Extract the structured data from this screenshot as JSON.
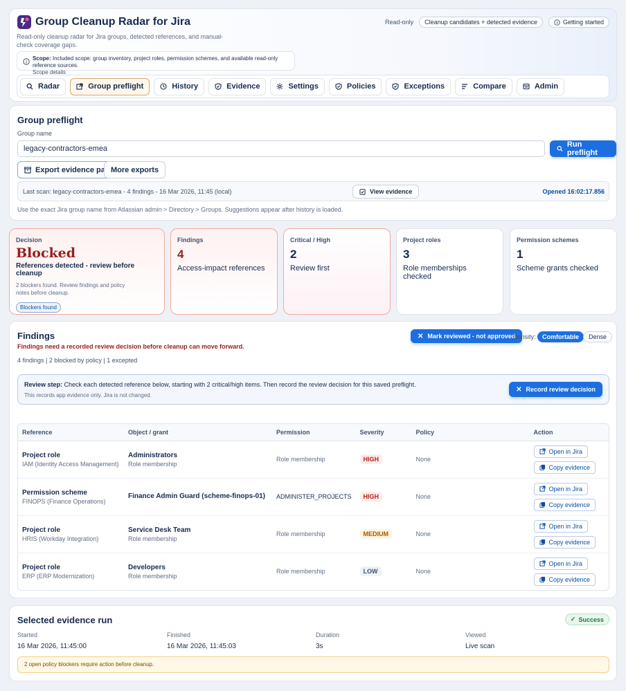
{
  "header": {
    "title": "Group Cleanup Radar for Jira",
    "subtitle": "Read-only cleanup radar for Jira groups, detected references, and manual-check coverage gaps.",
    "badges": {
      "readonly": "Read-only",
      "mode": "Cleanup candidates + detected evidence",
      "getting_started": "Getting started"
    },
    "scope_label": "Scope:",
    "scope_text": "Included scope: group inventory, project roles, permission schemes, and available read-only reference sources.",
    "scope_link": "Scope details"
  },
  "nav": {
    "items": [
      {
        "label": "Radar",
        "icon": "search-icon"
      },
      {
        "label": "Group preflight",
        "icon": "external-link-icon",
        "active": true
      },
      {
        "label": "History",
        "icon": "clock-icon"
      },
      {
        "label": "Evidence",
        "icon": "shield-check-icon"
      },
      {
        "label": "Settings",
        "icon": "gear-icon"
      },
      {
        "label": "Policies",
        "icon": "shield-check-icon"
      },
      {
        "label": "Exceptions",
        "icon": "shield-check-icon"
      },
      {
        "label": "Compare",
        "icon": "list-icon"
      },
      {
        "label": "Admin",
        "icon": "admin-icon"
      }
    ]
  },
  "preflight": {
    "title": "Group preflight",
    "group_label": "Group name",
    "group_value": "legacy-contractors-emea",
    "run_button": "Run preflight",
    "export_button": "Export evidence pack",
    "more_exports": "More exports",
    "last_scan": "Last scan: legacy-contractors-emea - 4 findings - 16 Mar 2026, 11:45 (local)",
    "view_evidence": "View evidence",
    "opened": "Opened 16:02:17.856",
    "hint": "Use the exact Jira group name from Atlassian admin > Directory > Groups. Suggestions appear after history is loaded."
  },
  "stats": {
    "decision": {
      "label": "Decision",
      "value": "Blocked",
      "headline": "References detected - review before cleanup",
      "note": "2 blockers found. Review findings and policy notes before cleanup.",
      "tag": "Blockers found"
    },
    "findings": {
      "label": "Findings",
      "value": "4",
      "sub": "Access-impact references"
    },
    "critical": {
      "label": "Critical / High",
      "value": "2",
      "sub": "Review first"
    },
    "roles": {
      "label": "Project roles",
      "value": "3",
      "sub": "Role memberships checked"
    },
    "schemes": {
      "label": "Permission schemes",
      "value": "1",
      "sub": "Scheme grants checked"
    }
  },
  "findings": {
    "title": "Findings",
    "warning": "Findings need a recorded review decision before cleanup can move forward.",
    "summary": "4 findings | 2 blocked by policy | 1 excepted",
    "mark_button": "Mark reviewed - not approved",
    "density_label": "Density:",
    "density_options": [
      "Comfortable",
      "Dense"
    ],
    "review_label": "Review step:",
    "review_text": "Check each detected reference below, starting with 2 critical/high items. Then record the review decision for this saved preflight.",
    "review_note": "This records app evidence only. Jira is not changed.",
    "record_button": "Record review decision",
    "columns": [
      "Reference",
      "Object / grant",
      "Permission",
      "Severity",
      "Policy",
      "Action"
    ],
    "open_label": "Open in Jira",
    "copy_label": "Copy evidence",
    "rows": [
      {
        "ref": "Project role",
        "ref_sub": "IAM (Identity Access Management)",
        "obj": "Administrators",
        "obj_sub": "Role membership",
        "perm": "Role membership",
        "severity": "HIGH",
        "sev_class": "high",
        "policy": "None"
      },
      {
        "ref": "Permission scheme",
        "ref_sub": "FINOPS (Finance Operations)",
        "obj": "Finance Admin Guard (scheme-finops-01)",
        "obj_sub": "",
        "perm": "ADMINISTER_PROJECTS",
        "severity": "HIGH",
        "sev_class": "high",
        "policy": "None"
      },
      {
        "ref": "Project role",
        "ref_sub": "HRIS (Workday Integration)",
        "obj": "Service Desk Team",
        "obj_sub": "Role membership",
        "perm": "Role membership",
        "severity": "MEDIUM",
        "sev_class": "medium",
        "policy": "None"
      },
      {
        "ref": "Project role",
        "ref_sub": "ERP (ERP Modernization)",
        "obj": "Developers",
        "obj_sub": "Role membership",
        "perm": "Role membership",
        "severity": "LOW",
        "sev_class": "low",
        "policy": "None"
      }
    ]
  },
  "evidence_run": {
    "title": "Selected evidence run",
    "status": "Success",
    "fields": [
      {
        "label": "Started",
        "value": "16 Mar 2026, 11:45:00"
      },
      {
        "label": "Finished",
        "value": "16 Mar 2026, 11:45:03"
      },
      {
        "label": "Duration",
        "value": "3s"
      },
      {
        "label": "Viewed",
        "value": "Live scan"
      }
    ],
    "alert": "2 open policy blockers require action before cleanup."
  }
}
